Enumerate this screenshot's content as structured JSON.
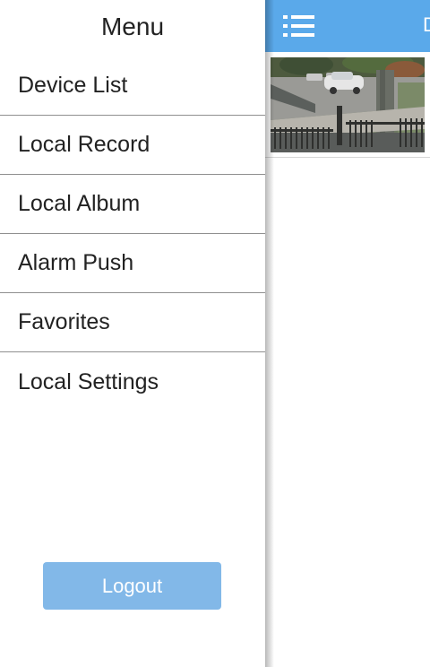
{
  "drawer": {
    "title": "Menu",
    "items": [
      {
        "label": "Device List"
      },
      {
        "label": "Local Record"
      },
      {
        "label": "Local Album"
      },
      {
        "label": "Alarm Push"
      },
      {
        "label": "Favorites"
      },
      {
        "label": "Local Settings"
      }
    ],
    "logout_label": "Logout"
  },
  "main": {
    "topbar": {
      "menu_icon": "list-menu-icon",
      "title_fragment": "D"
    },
    "camera_thumbnail": {
      "icon": "camera-snapshot"
    }
  },
  "colors": {
    "topbar": "#5aa9ea",
    "logout_button": "#82b8e8",
    "divider": "#8f8f8f",
    "text": "#222222"
  }
}
